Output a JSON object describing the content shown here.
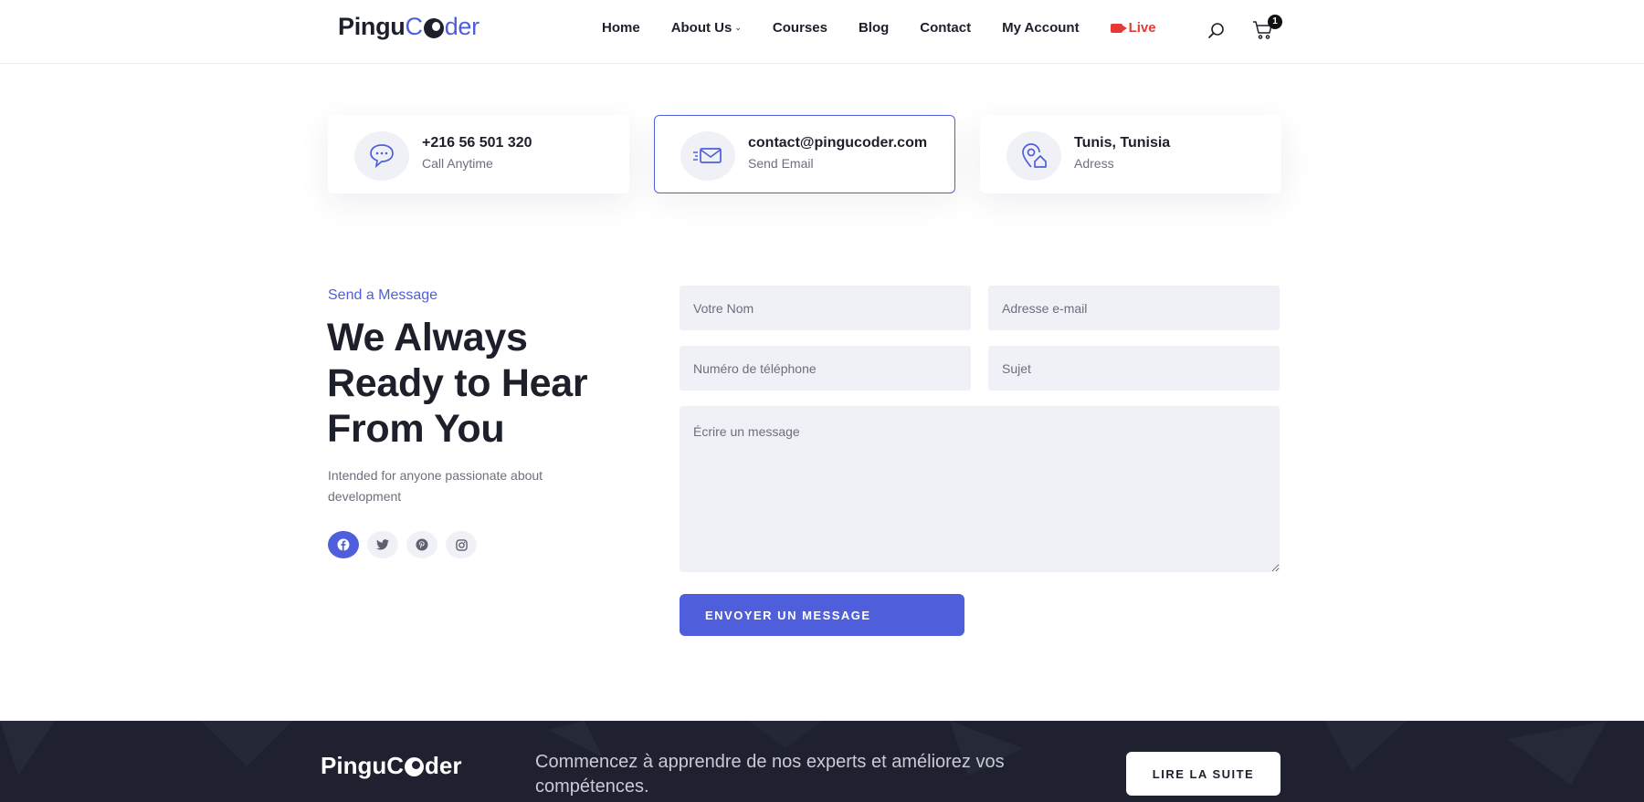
{
  "header": {
    "logo": {
      "part1": "Pingu",
      "part2": "C",
      "part3": "der"
    },
    "nav": [
      {
        "label": "Home"
      },
      {
        "label": "About Us"
      },
      {
        "label": "Courses"
      },
      {
        "label": "Blog"
      },
      {
        "label": "Contact"
      },
      {
        "label": "My Account"
      },
      {
        "label": "Live"
      }
    ],
    "cart_count": "1"
  },
  "contact_cards": [
    {
      "title": "+216 56 501 320",
      "subtitle": "Call Anytime",
      "icon": "chat-bubble-icon"
    },
    {
      "title": "contact@pingucoder.com",
      "subtitle": "Send Email",
      "icon": "envelope-icon"
    },
    {
      "title": "Tunis, Tunisia",
      "subtitle": "Adress",
      "icon": "location-home-icon"
    }
  ],
  "message_section": {
    "eyebrow": "Send a Message",
    "headline": "We Always Ready to Hear From You",
    "description": "Intended for anyone passionate about development",
    "socials": [
      "facebook-icon",
      "twitter-icon",
      "pinterest-icon",
      "instagram-icon"
    ]
  },
  "form": {
    "name_placeholder": "Votre Nom",
    "email_placeholder": "Adresse e-mail",
    "phone_placeholder": "Numéro de téléphone",
    "subject_placeholder": "Sujet",
    "message_placeholder": "Écrire un message",
    "submit_label": "ENVOYER UN MESSAGE"
  },
  "footer": {
    "logo": {
      "part1": "Pingu",
      "part2": "C",
      "part3": "der"
    },
    "text": "Commencez à apprendre de nos experts et améliorez vos compétences.",
    "button_label": "LIRE LA SUITE"
  },
  "colors": {
    "accent": "#4f5fdb",
    "dark": "#1d1f2b",
    "live": "#e53935",
    "field_bg": "#f0f1f6",
    "footer_bg": "#1f2130"
  }
}
